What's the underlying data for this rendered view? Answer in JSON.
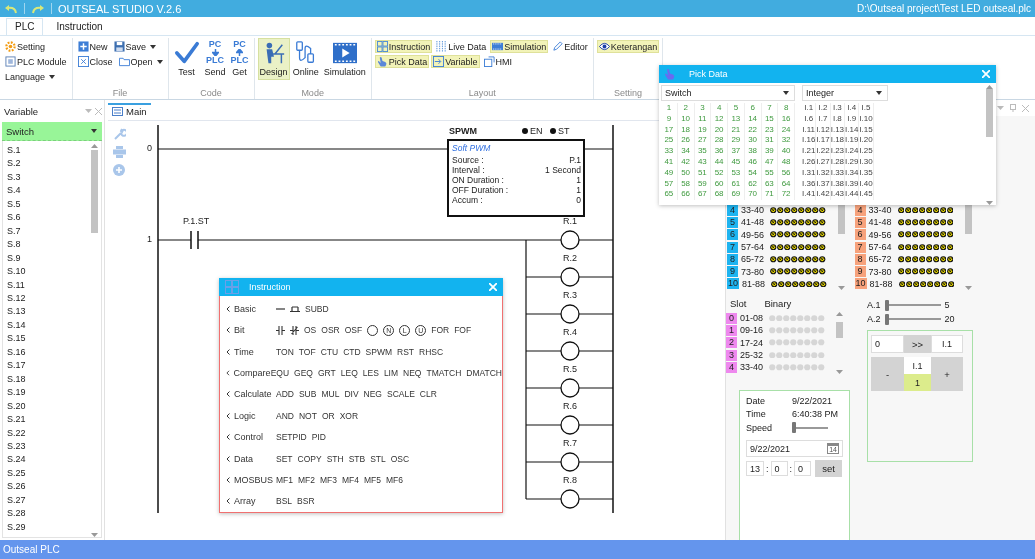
{
  "window": {
    "title": "OUTSEAL STUDIO V.2.6",
    "file_path": "D:\\Outseal project\\Test LED outseal.plc"
  },
  "menu_tabs": [
    {
      "label": "PLC",
      "selected": true
    },
    {
      "label": "Instruction",
      "selected": false
    }
  ],
  "ribbon": {
    "groups": [
      {
        "rows": [
          [
            {
              "label": "Setting",
              "dropdown": false
            }
          ],
          [
            {
              "label": "PLC Module",
              "dropdown": false
            }
          ],
          [
            {
              "label": "Language",
              "dropdown": true
            }
          ]
        ]
      },
      {
        "label": "File",
        "rows": [
          [
            {
              "label": "New",
              "dropdown": false
            },
            {
              "label": "Save",
              "dropdown": true
            }
          ],
          [
            {
              "label": "Close",
              "dropdown": false
            },
            {
              "label": "Open",
              "dropdown": true
            }
          ]
        ]
      },
      {
        "label": "Code",
        "large": [
          {
            "label": "Test",
            "selected": false
          },
          {
            "label": "Send",
            "selected": false,
            "icon_text": [
              "PC",
              "PLC"
            ]
          },
          {
            "label": "Get",
            "selected": false,
            "icon_text": [
              "PC",
              "PLC"
            ]
          }
        ]
      },
      {
        "label": "Mode",
        "large": [
          {
            "label": "Design",
            "selected": true
          },
          {
            "label": "Online",
            "selected": false
          },
          {
            "label": "Simulation",
            "selected": false
          }
        ]
      },
      {
        "label": "Layout",
        "rows": [
          [
            {
              "label": "Instruction",
              "on": true
            },
            {
              "label": "Live Data",
              "on": false
            },
            {
              "label": "Simulation",
              "on": true
            },
            {
              "label": "Editor",
              "on": false
            }
          ],
          [
            {
              "label": "Pick Data",
              "on": true
            },
            {
              "label": "Variable",
              "on": true
            },
            {
              "label": "HMI",
              "on": false
            }
          ]
        ]
      },
      {
        "label": "Setting",
        "rows": [
          [
            {
              "label": "Keterangan",
              "on": true
            }
          ]
        ]
      }
    ]
  },
  "variable_panel": {
    "title": "Variable",
    "filter": "Switch",
    "items": [
      "S.1",
      "S.2",
      "S.3",
      "S.4",
      "S.5",
      "S.6",
      "S.7",
      "S.8",
      "S.9",
      "S.10",
      "S.11",
      "S.12",
      "S.13",
      "S.14",
      "S.15",
      "S.16",
      "S.17",
      "S.18",
      "S.19",
      "S.20",
      "S.21",
      "S.22",
      "S.23",
      "S.24",
      "S.25",
      "S.26",
      "S.27",
      "S.28",
      "S.29"
    ]
  },
  "editor": {
    "tab": "Main",
    "rungs": [
      {
        "number": "0",
        "block": {
          "name": "SPWM",
          "flags": [
            "EN",
            "ST"
          ],
          "subtitle": "Soft PWM",
          "fields": [
            {
              "label": "Source :",
              "value": "P.1"
            },
            {
              "label": "Interval :",
              "value": "1 Second"
            },
            {
              "label": "ON Duration :",
              "value": "1"
            },
            {
              "label": "OFF Duration :",
              "value": "1"
            },
            {
              "label": "Accum :",
              "value": "0"
            }
          ]
        }
      },
      {
        "number": "1",
        "contact": "P.1.ST",
        "coils": [
          "R.1",
          "R.2",
          "R.3",
          "R.4",
          "R.5",
          "R.6",
          "R.7",
          "R.8"
        ]
      }
    ]
  },
  "hmi_panel": {
    "switch_slots": [
      {
        "slot": "4",
        "range": "33-40"
      },
      {
        "slot": "5",
        "range": "41-48"
      },
      {
        "slot": "6",
        "range": "49-56"
      },
      {
        "slot": "7",
        "range": "57-64"
      },
      {
        "slot": "8",
        "range": "65-72"
      },
      {
        "slot": "9",
        "range": "73-80"
      },
      {
        "slot": "10",
        "range": "81-88"
      }
    ],
    "output_slots": [
      {
        "slot": "4",
        "range": "33-40"
      },
      {
        "slot": "5",
        "range": "41-48"
      },
      {
        "slot": "6",
        "range": "49-56"
      },
      {
        "slot": "7",
        "range": "57-64"
      },
      {
        "slot": "8",
        "range": "65-72"
      },
      {
        "slot": "9",
        "range": "73-80"
      },
      {
        "slot": "10",
        "range": "81-88"
      }
    ],
    "binary": {
      "headers": [
        "Slot",
        "Binary"
      ],
      "rows": [
        {
          "slot": "0",
          "range": "01-08"
        },
        {
          "slot": "1",
          "range": "09-16"
        },
        {
          "slot": "2",
          "range": "17-24"
        },
        {
          "slot": "3",
          "range": "25-32"
        },
        {
          "slot": "4",
          "range": "33-40"
        }
      ]
    },
    "analogs": [
      {
        "label": "A.1",
        "level": 0,
        "value": "5"
      },
      {
        "label": "A.2",
        "level": 0,
        "value": "20"
      }
    ],
    "clock": {
      "date_label": "Date",
      "date": "9/22/2021",
      "time_label": "Time",
      "time": "6:40:38 PM",
      "speed": {
        "label": "Speed",
        "level": 0
      },
      "date_field": "9/22/2021",
      "calendar_day": "14",
      "hour": "13",
      "minute": "0",
      "second": "0",
      "separators": [
        ":",
        ":"
      ],
      "set_button": "set"
    },
    "value_box": {
      "value": "0",
      "send_button": ">>",
      "target": "I.1",
      "minus_button": "-",
      "plus_button": "+",
      "variable": "I.1",
      "reading": "1"
    }
  },
  "instruction_popup": {
    "title": "Instruction",
    "categories": [
      {
        "name": "Basic",
        "items": [
          {
            "kind": "line"
          },
          {
            "kind": "branch"
          },
          {
            "kind": "text",
            "text": "SUBD"
          }
        ]
      },
      {
        "name": "Bit",
        "items": [
          {
            "kind": "contact_no"
          },
          {
            "kind": "contact_nc"
          },
          {
            "kind": "text",
            "text": "OS"
          },
          {
            "kind": "text",
            "text": "OSR"
          },
          {
            "kind": "text",
            "text": "OSF"
          },
          {
            "kind": "coil"
          },
          {
            "kind": "coil",
            "text": "N"
          },
          {
            "kind": "coil",
            "text": "L"
          },
          {
            "kind": "coil",
            "text": "U"
          },
          {
            "kind": "text",
            "text": "FOR"
          },
          {
            "kind": "text",
            "text": "FOF"
          }
        ]
      },
      {
        "name": "Time",
        "items": [
          {
            "kind": "text",
            "text": "TON"
          },
          {
            "kind": "text",
            "text": "TOF"
          },
          {
            "kind": "text",
            "text": "CTU"
          },
          {
            "kind": "text",
            "text": "CTD"
          },
          {
            "kind": "text",
            "text": "SPWM"
          },
          {
            "kind": "text",
            "text": "RST"
          },
          {
            "kind": "text",
            "text": "RHSC"
          }
        ]
      },
      {
        "name": "Compare",
        "items": [
          {
            "kind": "text",
            "text": "EQU"
          },
          {
            "kind": "text",
            "text": "GEQ"
          },
          {
            "kind": "text",
            "text": "GRT"
          },
          {
            "kind": "text",
            "text": "LEQ"
          },
          {
            "kind": "text",
            "text": "LES"
          },
          {
            "kind": "text",
            "text": "LIM"
          },
          {
            "kind": "text",
            "text": "NEQ"
          },
          {
            "kind": "text",
            "text": "TMATCH"
          },
          {
            "kind": "text",
            "text": "DMATCH"
          }
        ]
      },
      {
        "name": "Calculate",
        "items": [
          {
            "kind": "text",
            "text": "ADD"
          },
          {
            "kind": "text",
            "text": "SUB"
          },
          {
            "kind": "text",
            "text": "MUL"
          },
          {
            "kind": "text",
            "text": "DIV"
          },
          {
            "kind": "text",
            "text": "NEG"
          },
          {
            "kind": "text",
            "text": "SCALE"
          },
          {
            "kind": "text",
            "text": "CLR"
          }
        ]
      },
      {
        "name": "Logic",
        "items": [
          {
            "kind": "text",
            "text": "AND"
          },
          {
            "kind": "text",
            "text": "NOT"
          },
          {
            "kind": "text",
            "text": "OR"
          },
          {
            "kind": "text",
            "text": "XOR"
          }
        ]
      },
      {
        "name": "Control",
        "items": [
          {
            "kind": "text",
            "text": "SETPID"
          },
          {
            "kind": "text",
            "text": "PID"
          }
        ]
      },
      {
        "name": "Data",
        "items": [
          {
            "kind": "text",
            "text": "SET"
          },
          {
            "kind": "text",
            "text": "COPY"
          },
          {
            "kind": "text",
            "text": "STH"
          },
          {
            "kind": "text",
            "text": "STB"
          },
          {
            "kind": "text",
            "text": "STL"
          },
          {
            "kind": "text",
            "text": "OSC"
          }
        ]
      },
      {
        "name": "MOSBUS",
        "items": [
          {
            "kind": "text",
            "text": "MF1"
          },
          {
            "kind": "text",
            "text": "MF2"
          },
          {
            "kind": "text",
            "text": "MF3"
          },
          {
            "kind": "text",
            "text": "MF4"
          },
          {
            "kind": "text",
            "text": "MF5"
          },
          {
            "kind": "text",
            "text": "MF6"
          }
        ]
      },
      {
        "name": "Array",
        "items": [
          {
            "kind": "text",
            "text": "BSL"
          },
          {
            "kind": "text",
            "text": "BSR"
          }
        ]
      }
    ]
  },
  "pick_data_popup": {
    "title": "Pick Data",
    "type": "Switch",
    "format": "Integer",
    "switches": [
      "1",
      "2",
      "3",
      "4",
      "5",
      "6",
      "7",
      "8",
      "9",
      "10",
      "11",
      "12",
      "13",
      "14",
      "15",
      "16",
      "17",
      "18",
      "19",
      "20",
      "21",
      "22",
      "23",
      "24",
      "25",
      "26",
      "27",
      "28",
      "29",
      "30",
      "31",
      "32",
      "33",
      "34",
      "35",
      "36",
      "37",
      "38",
      "39",
      "40",
      "41",
      "42",
      "43",
      "44",
      "45",
      "46",
      "47",
      "48",
      "49",
      "50",
      "51",
      "52",
      "53",
      "54",
      "55",
      "56",
      "57",
      "58",
      "59",
      "60",
      "61",
      "62",
      "63",
      "64",
      "65",
      "66",
      "67",
      "68",
      "69",
      "70",
      "71",
      "72"
    ],
    "integers": [
      "I.1",
      "I.2",
      "I.3",
      "I.4",
      "I.5",
      "I.6",
      "I.7",
      "I.8",
      "I.9",
      "I.10",
      "I.11",
      "I.12",
      "I.13",
      "I.14",
      "I.15",
      "I.16",
      "I.17",
      "I.18",
      "I.19",
      "I.20",
      "I.21",
      "I.22",
      "I.23",
      "I.24",
      "I.25",
      "I.26",
      "I.27",
      "I.28",
      "I.29",
      "I.30",
      "I.31",
      "I.32",
      "I.33",
      "I.34",
      "I.35",
      "I.36",
      "I.37",
      "I.38",
      "I.39",
      "I.40",
      "I.41",
      "I.42",
      "I.43",
      "I.44",
      "I.45"
    ]
  },
  "status_bar": "Outseal PLC"
}
